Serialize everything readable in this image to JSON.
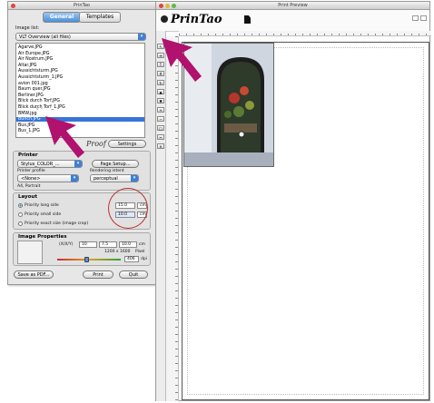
{
  "palette": {
    "title": "PrinTao",
    "tabs": [
      {
        "label": "General",
        "active": true
      },
      {
        "label": "Templates",
        "active": false
      }
    ],
    "image_list_label": "Image list:",
    "image_list_select": "VLT Overview (all files)",
    "files": [
      "Agarve.JPG",
      "Air Europe.JPG",
      "Air Nostrum.JPG",
      "Altar.JPG",
      "Aussichtsturm.JPG",
      "Aussichtsturm_1.JPG",
      "avion 001.jpg",
      "Baum quer.JPG",
      "Berliner.JPG",
      "Blick durch Torf.JPG",
      "Blick durch Torf_1.JPG",
      "BMW.jpg",
      "Bunch.JPG",
      "Bus.JPG",
      "Bus_1.JPG"
    ],
    "selected_file": "Bunch.JPG",
    "proof_label": "Proof",
    "settings_button": "Settings",
    "printer": {
      "heading": "Printer",
      "printer_select": "Stylus_COLOR_...",
      "page_setup_button": "Page Setup...",
      "profile_label": "Printer profile",
      "profile_select": "<None>",
      "intent_label": "Rendering intent",
      "intent_select": "perceptual",
      "paper_info": "A4, Portrait"
    },
    "layout": {
      "heading": "Layout",
      "options": [
        {
          "label": "Priority  long side",
          "value": "15.0",
          "unit": "cm",
          "selected": true
        },
        {
          "label": "Priority  small side",
          "value": "10.0",
          "unit": "cm",
          "selected": false
        },
        {
          "label": "Priority  exact size (image crop)",
          "selected": false
        }
      ]
    },
    "image_properties": {
      "heading": "Image Properties",
      "dim_label": "(X/X/Y)",
      "fields": [
        "10",
        "7.5",
        "10.0"
      ],
      "size_unit": "cm",
      "pixels": "1200  x  1600",
      "pixels_unit": "Pixel",
      "dpi_value": "406",
      "dpi_unit": "dpi",
      "slider_level": 0.45
    },
    "save_pdf_button": "Save as PDF...",
    "print_button": "Print",
    "quit_button": "Quit"
  },
  "main": {
    "title": "Print Preview",
    "logo": "PrinTao",
    "tool_icons": [
      "pointer-icon",
      "move-icon",
      "text-icon",
      "grid-icon",
      "rotate-icon",
      "up-icon",
      "down-icon",
      "zoom-in-icon",
      "zoom-out-icon",
      "fit-icon",
      "crop-icon",
      "trash-icon"
    ]
  },
  "colors": {
    "selection": "#3875d7",
    "annotation": "#b33333",
    "pointer": "#b0126e"
  }
}
